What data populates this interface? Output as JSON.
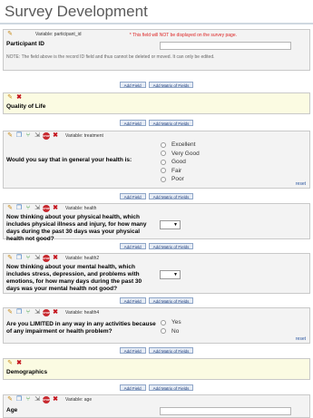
{
  "page": {
    "title": "Survey Development"
  },
  "buttons": {
    "add_field": "Add Field",
    "add_matrix": "Add Matrix of Fields"
  },
  "reset_label": "reset",
  "fields": {
    "participant_id": {
      "variable": "Variable: participant_id",
      "red_note": "* This field will NOT be displayed on the survey page.",
      "label": "Participant ID",
      "note": "NOTE: The field above is the record ID field and thus cannot be deleted or moved. It can only be edited."
    },
    "qol_header": {
      "label": "Quality of Life"
    },
    "treatment": {
      "variable": "Variable: treatment",
      "label": "Would you say that in general your health is:",
      "options": [
        "Excellent",
        "Very Good",
        "Good",
        "Fair",
        "Poor"
      ]
    },
    "health": {
      "variable": "Variable: health",
      "label": "Now thinking about your physical health, which includes physical illness and injury, for how many days during the past 30 days was your physical health not good?",
      "select_arrow": "▼"
    },
    "health2": {
      "variable": "Variable: health2",
      "label": "Now thinking about your mental health, which includes stress, depression, and problems with emotions, for how many days during the past 30 days was your mental health not good?",
      "select_arrow": "▼"
    },
    "health4": {
      "variable": "Variable: health4",
      "label": "Are you LIMITED in any way in any activities because of any impairment or health problem?",
      "options": [
        "Yes",
        "No"
      ]
    },
    "demo_header": {
      "label": "Demographics"
    },
    "age": {
      "variable": "Variable: age",
      "label": "Age"
    }
  },
  "icons": {
    "edit": "pencil-icon",
    "delete": "delete-icon",
    "copy": "copy-icon",
    "branch": "branching-icon",
    "move": "move-icon",
    "stop": "stop-icon"
  },
  "colors": {
    "title": "#5a5a5a",
    "field_bg": "#f3f3f3",
    "header_bg": "#fbfbe2",
    "red_note": "#dd2222",
    "link": "#2a55a0"
  }
}
